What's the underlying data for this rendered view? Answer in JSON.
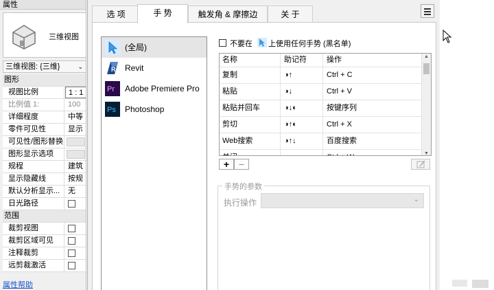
{
  "properties": {
    "title": "属性",
    "type_name": "三维视图",
    "selector": "三维视图: {三维}",
    "rows": [
      {
        "kind": "group",
        "label": "图形"
      },
      {
        "kind": "field",
        "label": "视图比例",
        "value": "1 : 1",
        "style": "sel"
      },
      {
        "kind": "field",
        "label": "比例值 1:",
        "value": "100",
        "style": "gray"
      },
      {
        "kind": "field",
        "label": "详细程度",
        "value": "中等"
      },
      {
        "kind": "field",
        "label": "零件可见性",
        "value": "显示"
      },
      {
        "kind": "button",
        "label": "可见性/图形替换"
      },
      {
        "kind": "button",
        "label": "图形显示选项"
      },
      {
        "kind": "field",
        "label": "规程",
        "value": "建筑"
      },
      {
        "kind": "field",
        "label": "显示隐藏线",
        "value": "按规"
      },
      {
        "kind": "field",
        "label": "默认分析显示...",
        "value": "无"
      },
      {
        "kind": "check",
        "label": "日光路径"
      },
      {
        "kind": "group",
        "label": "范围"
      },
      {
        "kind": "check",
        "label": "裁剪视图"
      },
      {
        "kind": "check",
        "label": "裁剪区域可见"
      },
      {
        "kind": "check",
        "label": "注释裁剪"
      },
      {
        "kind": "check",
        "label": "远剪裁激活"
      }
    ],
    "help_link": "属性帮助"
  },
  "dialog": {
    "tabs": [
      {
        "label": "选 项",
        "active": false
      },
      {
        "label": "手 势",
        "active": true
      },
      {
        "label": "触发角 & 摩擦边",
        "active": false
      },
      {
        "label": "关 于",
        "active": false
      }
    ],
    "apps": [
      {
        "name": "(全局)",
        "icon": "cursor-icon",
        "selected": true
      },
      {
        "name": "Revit",
        "icon": "revit-icon",
        "selected": false
      },
      {
        "name": "Adobe Premiere Pro",
        "icon": "premiere-icon",
        "icon_text": "Pr",
        "selected": false
      },
      {
        "name": "Photoshop",
        "icon": "photoshop-icon",
        "icon_text": "Ps",
        "selected": false
      }
    ],
    "blacklist": {
      "prefix": "不要在",
      "suffix": "上使用任何手势 (黑名单)"
    },
    "table": {
      "headers": [
        "名称",
        "助记符",
        "操作"
      ],
      "rows": [
        {
          "name": "复制",
          "mnemonic": "◑↑",
          "action": "Ctrl + C"
        },
        {
          "name": "粘贴",
          "mnemonic": "◑↓",
          "action": "Ctrl + V"
        },
        {
          "name": "粘贴并回车",
          "mnemonic": "◑↓◐",
          "action": "按键序列"
        },
        {
          "name": "剪切",
          "mnemonic": "◑↑◐",
          "action": "Ctrl + X"
        },
        {
          "name": "Web搜索",
          "mnemonic": "◑↑↓",
          "action": "百度搜索"
        },
        {
          "name": "关闭",
          "mnemonic": "◑←",
          "action": "Ctrl + W"
        }
      ]
    },
    "add_label": "+",
    "remove_label": "−",
    "params": {
      "legend": "手势的参数",
      "exec_label": "执行操作"
    }
  },
  "colors": {
    "premiere_bg": "#2a0a4a",
    "premiere_fg": "#e6a8ff",
    "photoshop_bg": "#031e35",
    "photoshop_fg": "#4fb6ff",
    "revit_bg": "#1b4a8c",
    "link": "#1a55c8"
  }
}
